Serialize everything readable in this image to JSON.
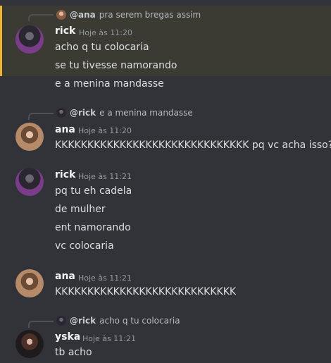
{
  "messages": [
    {
      "reply": {
        "user": "@ana",
        "text": "pra serem bregas assim",
        "avatar_icon": "ana-avatar-icon"
      },
      "author": "rick",
      "time": "Hoje às 11:20",
      "lines": [
        "acho q tu colocaria",
        "se tu tivesse namorando",
        "e a menina mandasse"
      ],
      "highlighted": true
    },
    {
      "reply": {
        "user": "@rick",
        "text": "e a menina mandasse",
        "avatar_icon": "rick-avatar-icon"
      },
      "author": "ana",
      "time": "Hoje às 11:20",
      "lines": [
        "KKKKKKKKKKKKKKKKKKKKKKKKKKKKKK pq vc acha isso?"
      ]
    },
    {
      "author": "rick",
      "time": "Hoje às 11:21",
      "lines": [
        "pq tu eh cadela",
        "de mulher",
        "ent namorando",
        "vc colocaria"
      ]
    },
    {
      "author": "ana",
      "time": "Hoje às 11:21",
      "lines": [
        "KKKKKKKKKKKKKKKKKKKKKKKKKKKK"
      ]
    },
    {
      "reply": {
        "user": "@rick",
        "text": "acho q tu colocaria",
        "avatar_icon": "rick-avatar-icon"
      },
      "author": "yska",
      "time": "Hoje às 11:21",
      "lines": [
        "tb acho"
      ]
    }
  ],
  "colors": {
    "background": "#313338",
    "highlight": "#3b3a33",
    "highlight_border": "#f0b232",
    "text": "#dbdee1",
    "timestamp": "#949ba4"
  }
}
